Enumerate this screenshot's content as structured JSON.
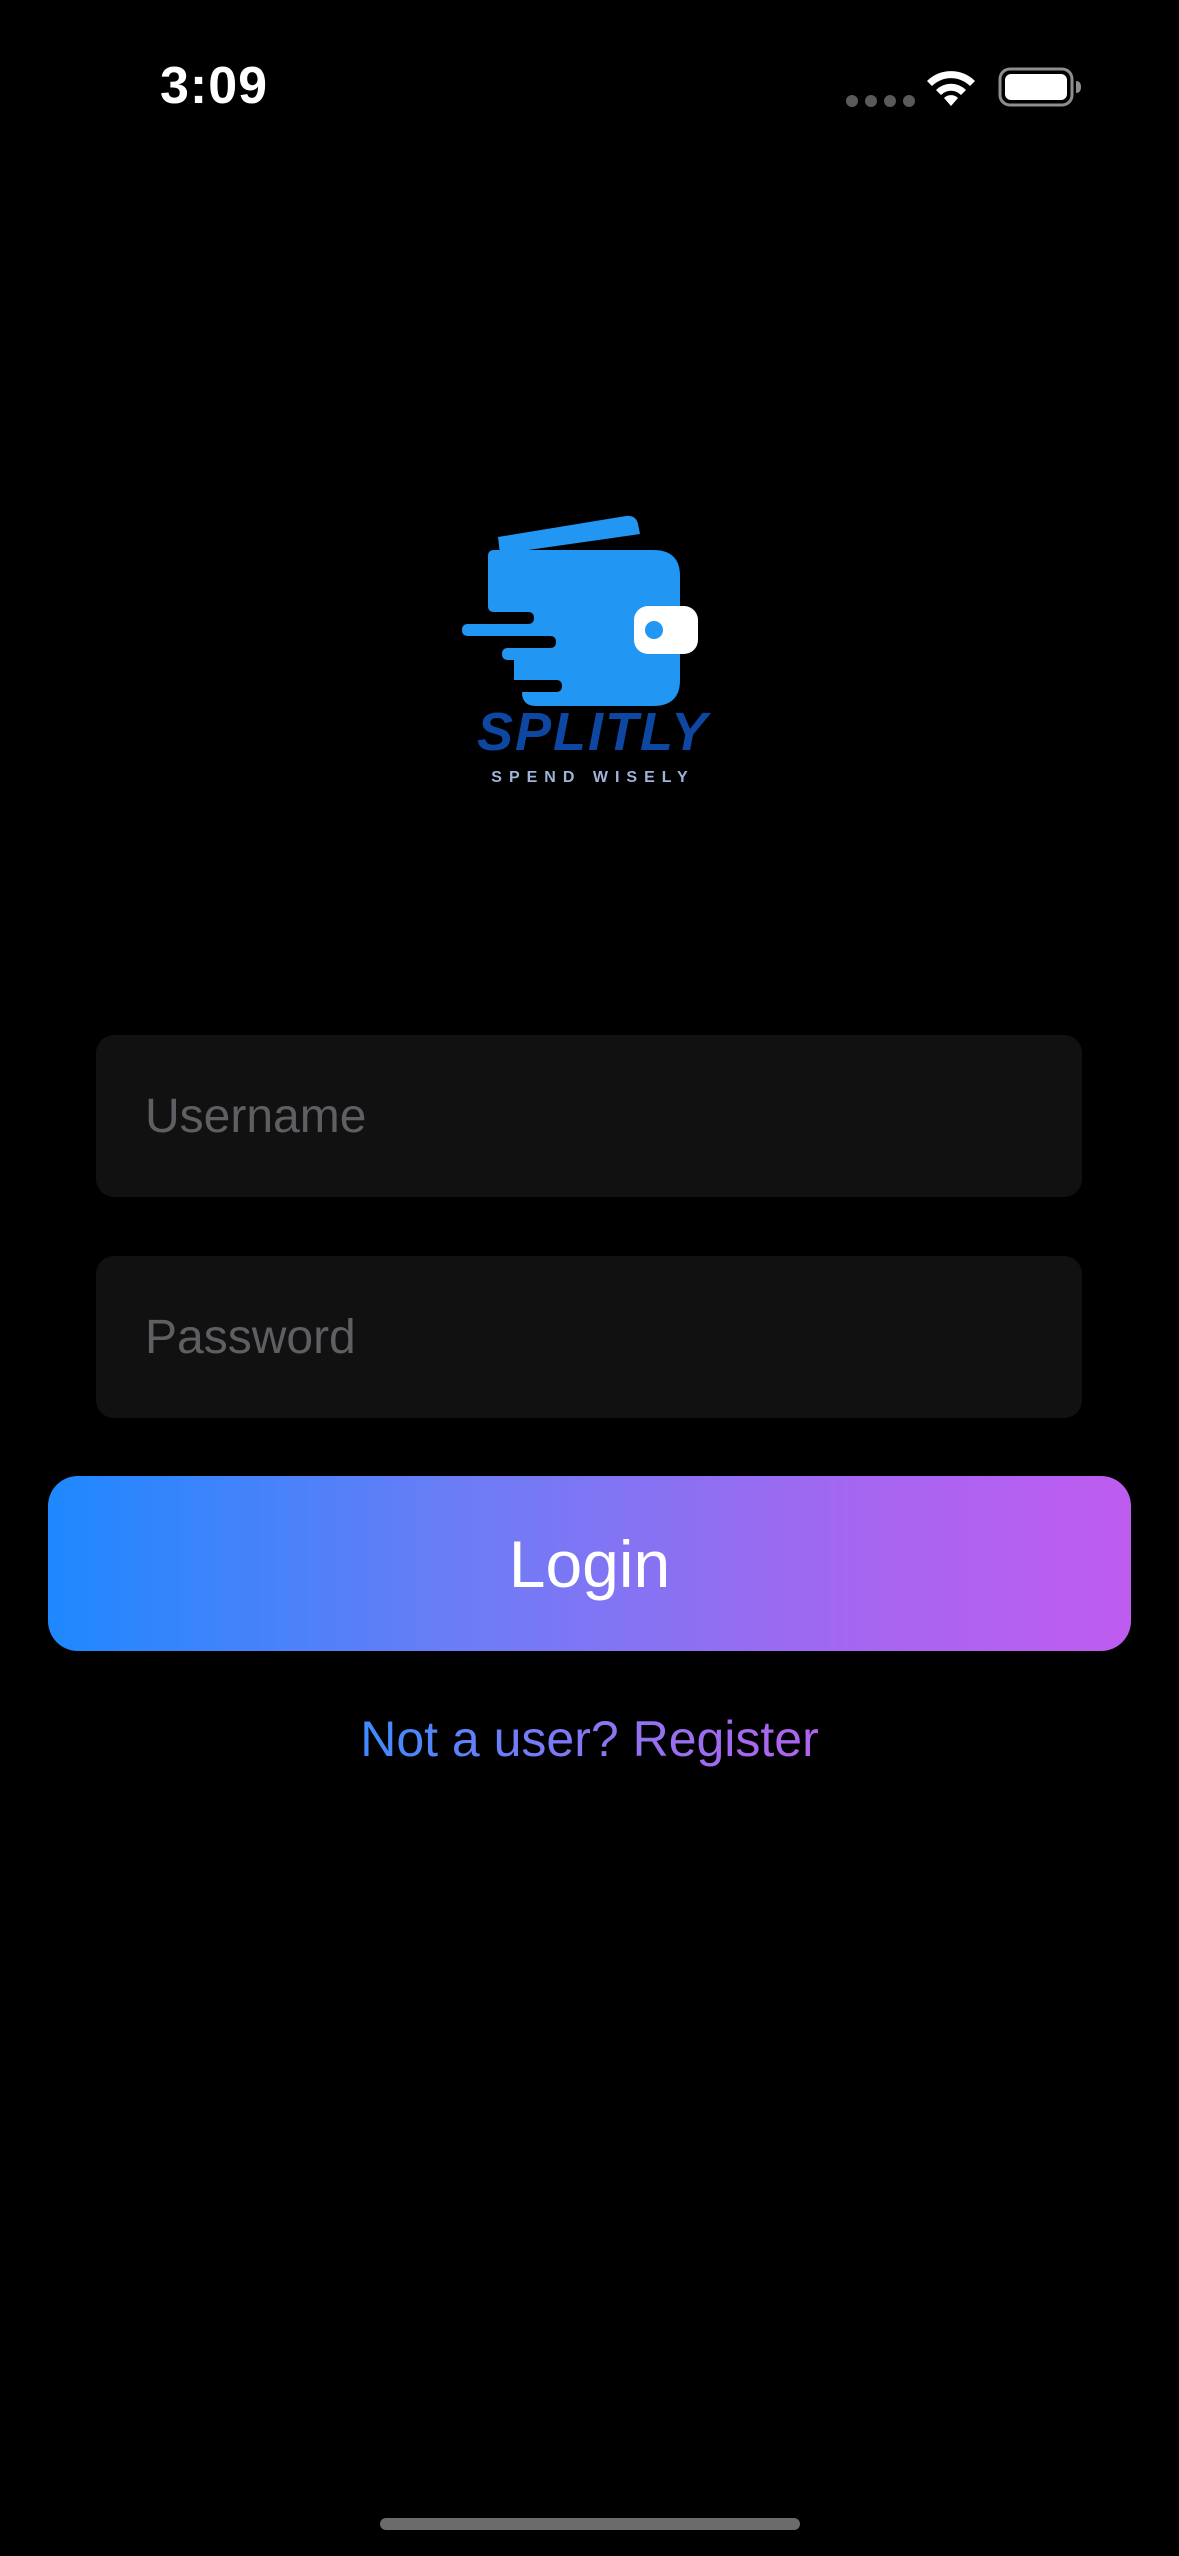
{
  "status_bar": {
    "time": "3:09",
    "icons": [
      "signal-dots-icon",
      "wifi-icon",
      "battery-icon"
    ]
  },
  "logo": {
    "name": "SPLITLY",
    "tagline": "SPEND WISELY",
    "colors": {
      "wallet": "#2196f3",
      "text": "#0d47a1"
    }
  },
  "form": {
    "username_placeholder": "Username",
    "username_value": "",
    "password_placeholder": "Password",
    "password_value": ""
  },
  "login_button": {
    "label": "Login",
    "gradient": [
      "#1e88ff",
      "#bf5cf0"
    ]
  },
  "register_link": {
    "label": "Not a user? Register"
  },
  "colors": {
    "background": "#000000",
    "field_background": "#111111",
    "placeholder": "#5f5f63"
  }
}
